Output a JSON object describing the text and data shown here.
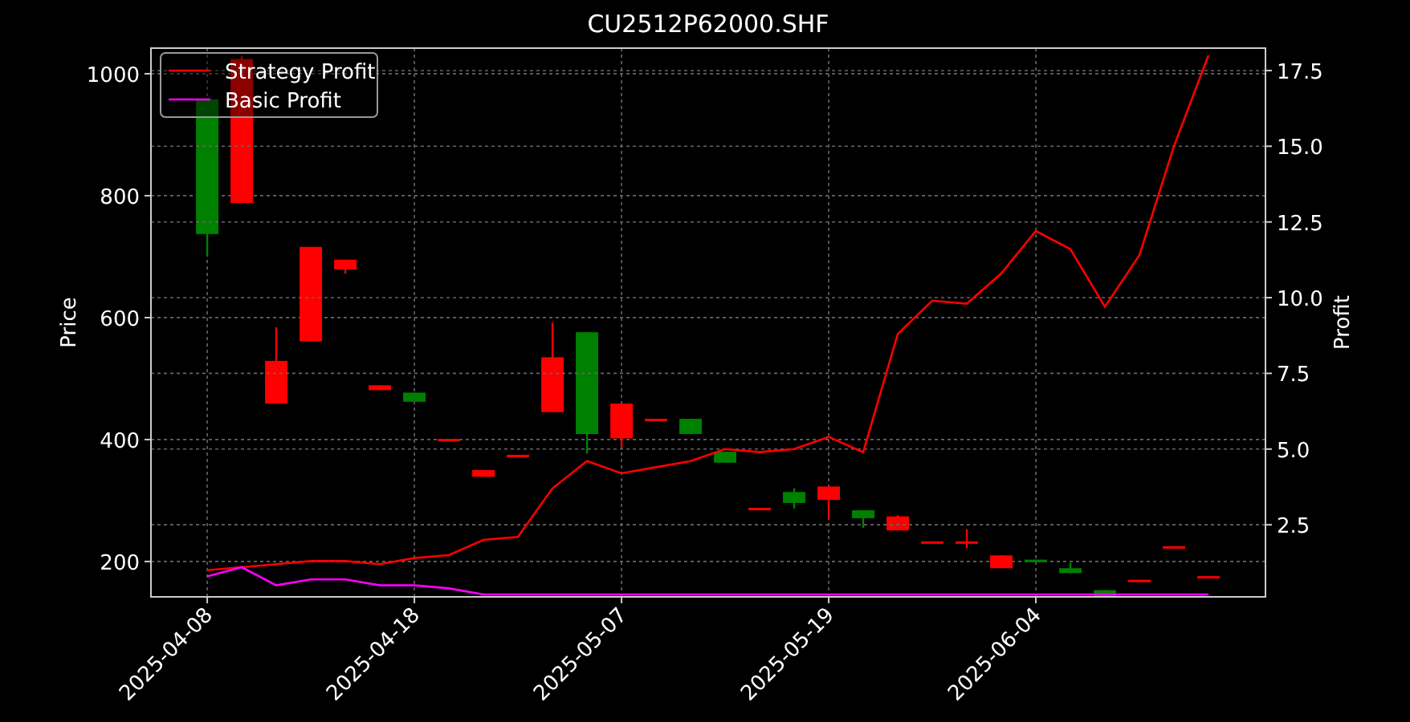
{
  "price_chart": {
    "chart_data": {
      "type": "candlestick",
      "title": "CU2512P62000.SHF",
      "ylabel": "Price",
      "grid": true,
      "categories": [
        "2025-04-08",
        null,
        null,
        null,
        null,
        null,
        "2025-04-18",
        null,
        null,
        null,
        null,
        null,
        "2025-05-07",
        null,
        null,
        null,
        null,
        null,
        "2025-05-19",
        null,
        null,
        null,
        null,
        null,
        "2025-06-04",
        null,
        null,
        null,
        null,
        null
      ],
      "ylim": [
        142,
        1042
      ],
      "yticks": [
        200,
        400,
        600,
        800,
        1000
      ],
      "ohlc": [
        [
          958,
          958,
          700,
          737
        ],
        [
          788,
          1029,
          788,
          1024
        ],
        [
          459,
          584,
          459,
          529
        ],
        [
          561,
          716,
          561,
          716
        ],
        [
          679,
          695,
          672,
          695
        ],
        [
          481,
          489,
          481,
          489
        ],
        [
          477,
          477,
          462,
          462
        ],
        [
          399,
          401,
          399,
          401
        ],
        [
          339,
          350,
          339,
          350
        ],
        [
          373,
          375,
          373,
          375
        ],
        [
          445,
          592,
          445,
          535
        ],
        [
          576,
          576,
          377,
          409
        ],
        [
          402,
          459,
          387,
          459
        ],
        [
          432,
          434,
          432,
          434
        ],
        [
          434,
          434,
          409,
          409
        ],
        [
          380,
          380,
          362,
          362
        ],
        [
          286,
          288,
          286,
          288
        ],
        [
          314,
          320,
          287,
          296
        ],
        [
          301,
          323,
          268,
          323
        ],
        [
          284,
          284,
          255,
          271
        ],
        [
          251,
          276,
          251,
          274
        ],
        [
          231,
          233,
          231,
          233
        ],
        [
          231,
          253,
          222,
          233
        ],
        [
          189,
          210,
          189,
          210
        ],
        [
          203,
          203,
          201,
          201
        ],
        [
          189,
          198,
          181,
          181
        ],
        [
          153,
          153,
          143,
          143
        ],
        [
          168,
          170,
          168,
          170
        ],
        [
          223,
          225,
          223,
          225
        ],
        [
          174,
          176,
          174,
          176
        ]
      ]
    }
  },
  "profit_chart": {
    "chart_data": {
      "type": "line",
      "ylabel": "Profit",
      "grid": true,
      "legend": "upper left",
      "categories": [
        null,
        null,
        null,
        null,
        null,
        null,
        null,
        null,
        null,
        null,
        null,
        null,
        null,
        null,
        null,
        null,
        null,
        null,
        null,
        null,
        null,
        null,
        null,
        null,
        null,
        null,
        null,
        null,
        null,
        null
      ],
      "ylim": [
        0.12,
        18.24
      ],
      "yticks": [
        {
          "value": 2.5,
          "label": "2.5"
        },
        {
          "value": 5,
          "label": "5.0"
        },
        {
          "value": 7.5,
          "label": "7.5"
        },
        {
          "value": 10,
          "label": "10.0"
        },
        {
          "value": 12.5,
          "label": "12.5"
        },
        {
          "value": 15,
          "label": "15.0"
        },
        {
          "value": 17.5,
          "label": "17.5"
        }
      ],
      "series": [
        {
          "name": "Strategy Profit",
          "color": "#ff0000",
          "values": [
            1.0,
            1.1,
            1.2,
            1.3,
            1.3,
            1.2,
            1.4,
            1.5,
            2.0,
            2.1,
            3.7,
            4.6,
            4.2,
            4.4,
            4.6,
            5.0,
            4.9,
            5.0,
            5.4,
            4.9,
            8.8,
            9.9,
            9.8,
            10.8,
            12.2,
            11.6,
            9.7,
            11.4,
            15.0,
            18.0
          ]
        },
        {
          "name": "Basic Profit",
          "color": "#ff00ff",
          "values": [
            0.8,
            1.1,
            0.5,
            0.7,
            0.7,
            0.5,
            0.5,
            0.4,
            0.2,
            0.2,
            0.2,
            0.2,
            0.2,
            0.2,
            0.2,
            0.2,
            0.2,
            0.2,
            0.2,
            0.2,
            0.2,
            0.2,
            0.2,
            0.2,
            0.2,
            0.2,
            0.2,
            0.2,
            0.2,
            0.2
          ]
        }
      ]
    }
  }
}
